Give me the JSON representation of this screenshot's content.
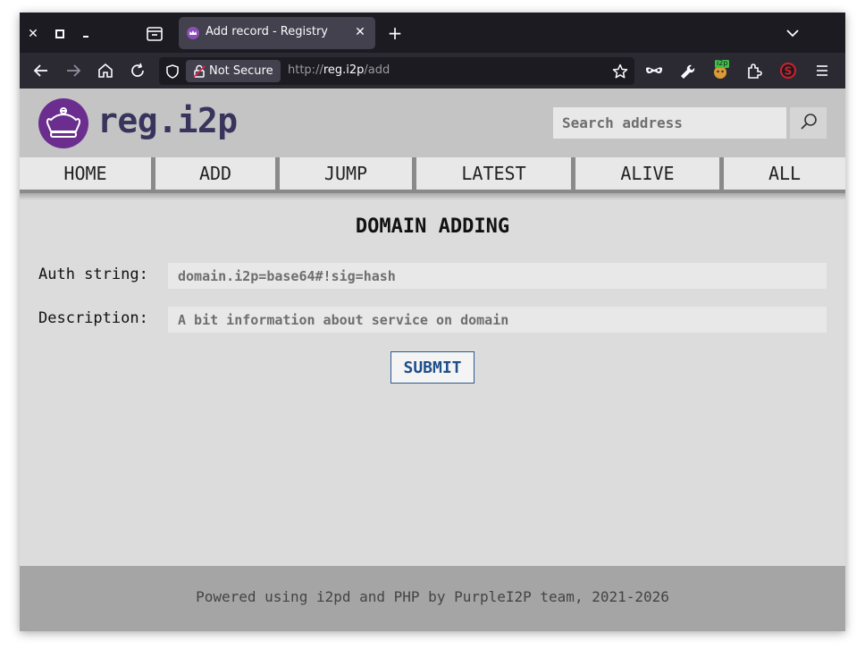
{
  "browser": {
    "tab": {
      "title": "Add record - Registry"
    },
    "urlbar": {
      "security_label": "Not Secure",
      "url_scheme": "http://",
      "url_host": "reg.i2p",
      "url_path": "/add"
    },
    "extensions": [
      "i2p"
    ]
  },
  "site": {
    "brand": "reg.i2p",
    "search_placeholder": "Search address",
    "menu": [
      "HOME",
      "ADD",
      "JUMP",
      "LATEST",
      "ALIVE",
      "ALL"
    ]
  },
  "form": {
    "title": "DOMAIN ADDING",
    "auth_label": "Auth string:",
    "auth_placeholder": "domain.i2p=base64#!sig=hash",
    "desc_label": "Description:",
    "desc_placeholder": "A bit information about service on domain",
    "submit_label": "SUBMIT"
  },
  "footer": {
    "text": "Powered using i2pd and PHP by PurpleI2P team, 2021-2026"
  },
  "colors": {
    "brand": "#38345c",
    "logo": "#6b2e8f",
    "submit": "#1d4f8a"
  }
}
